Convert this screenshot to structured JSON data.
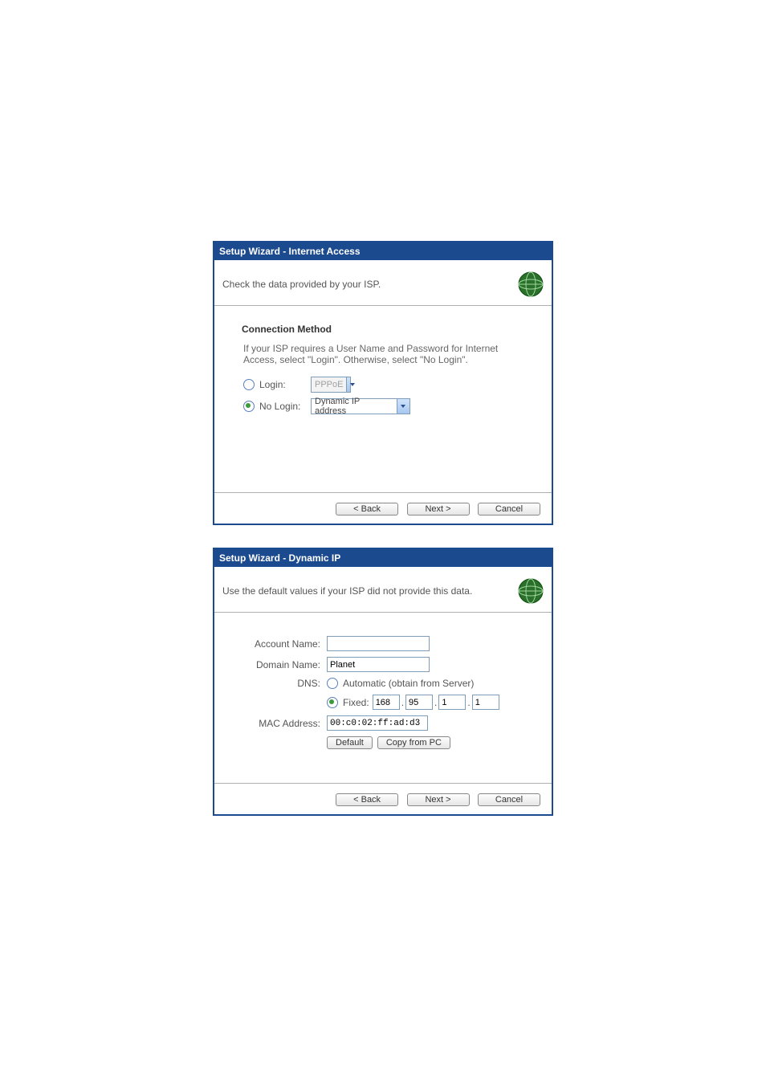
{
  "panel1": {
    "title": "Setup Wizard - Internet Access",
    "subtitle": "Check the data provided by your ISP.",
    "section_heading": "Connection Method",
    "hint": "If your ISP requires a User Name and Password for Internet Access, select \"Login\". Otherwise, select \"No Login\".",
    "login_label": "Login:",
    "nologin_label": "No Login:",
    "login_select": "PPPoE",
    "nologin_select": "Dynamic IP address",
    "back_label": "< Back",
    "next_label": "Next >",
    "cancel_label": "Cancel"
  },
  "panel2": {
    "title": "Setup Wizard - Dynamic IP",
    "subtitle": "Use the default values if your ISP did not provide this data.",
    "account_label": "Account Name:",
    "account_value": "",
    "domain_label": "Domain Name:",
    "domain_value": "Planet",
    "dns_label": "DNS:",
    "dns_auto_label": "Automatic (obtain from Server)",
    "dns_fixed_label": "Fixed:",
    "dns_ip": {
      "o1": "168",
      "o2": "95",
      "o3": "1",
      "o4": "1"
    },
    "mac_label": "MAC Address:",
    "mac_value": "00:c0:02:ff:ad:d3",
    "default_btn": "Default",
    "copy_btn": "Copy from PC",
    "back_label": "< Back",
    "next_label": "Next >",
    "cancel_label": "Cancel"
  }
}
